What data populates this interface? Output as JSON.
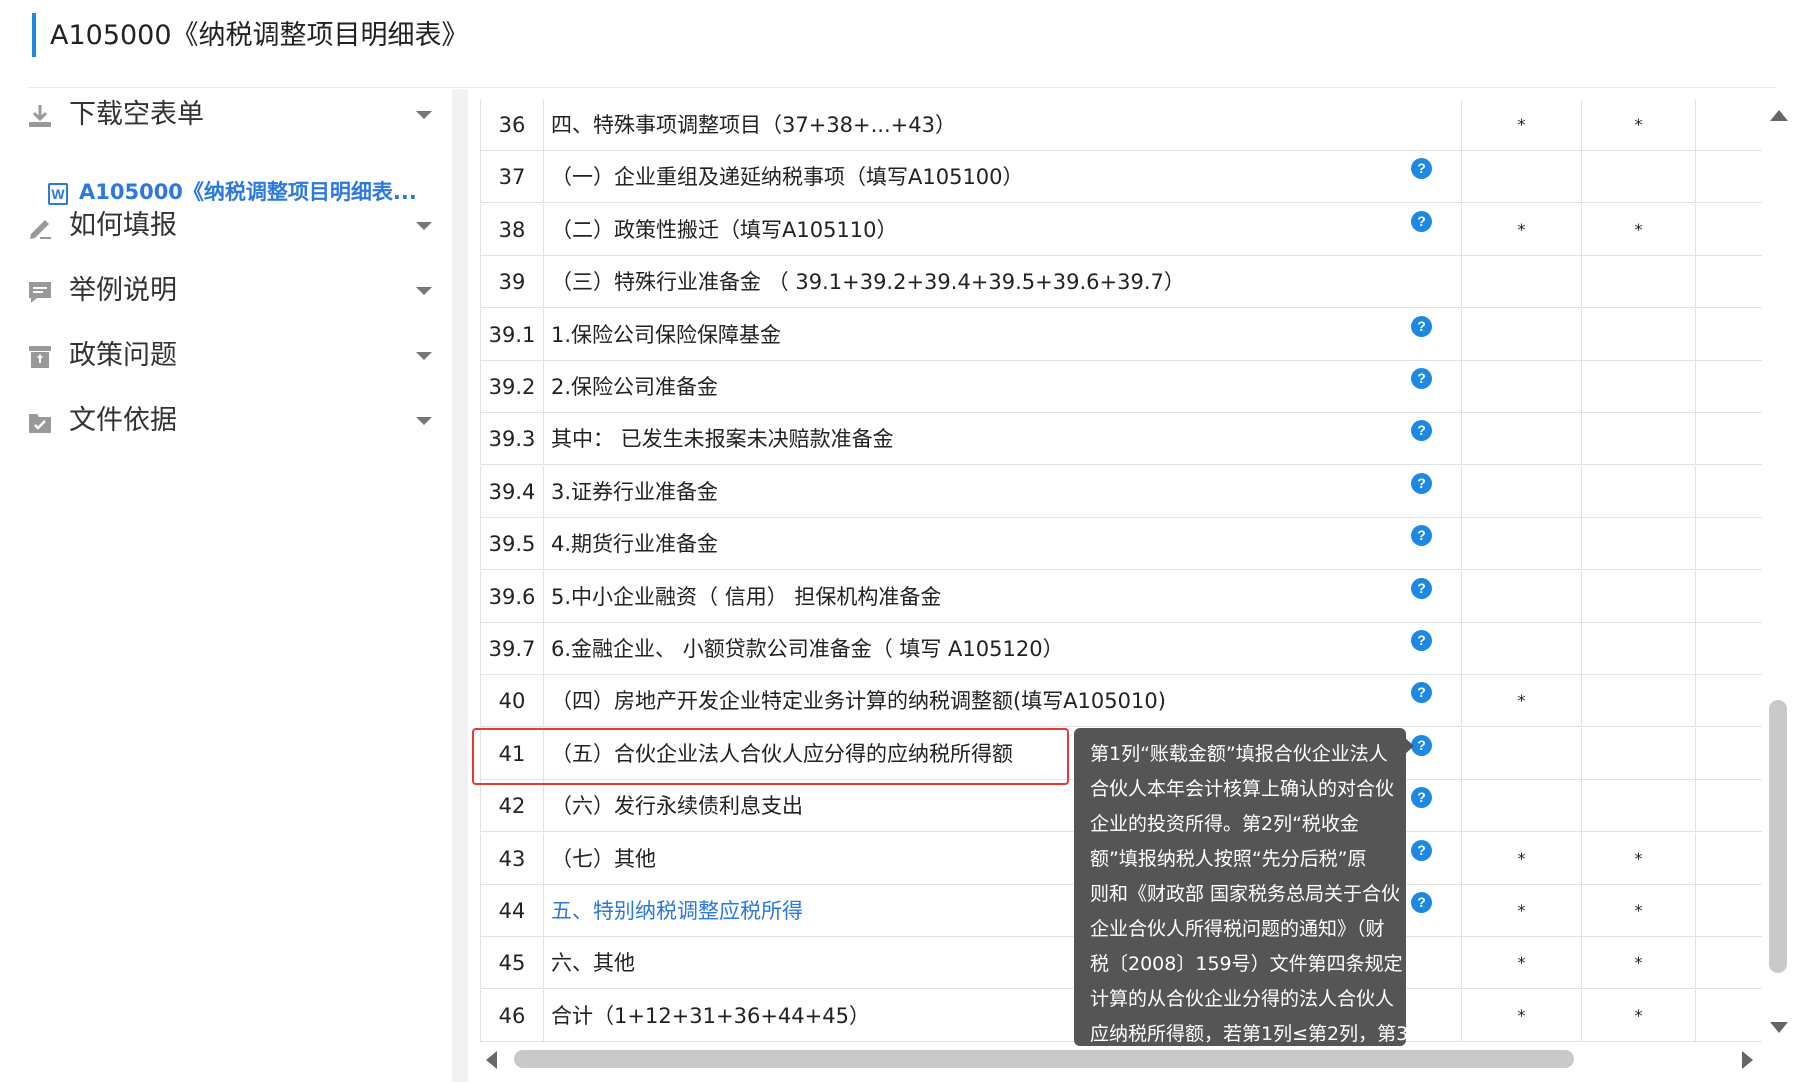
{
  "header": {
    "title": "A105000《纳税调整项目明细表》"
  },
  "sidebar": {
    "items": [
      {
        "label": "下载空表单",
        "icon": "download-icon"
      },
      {
        "label": "如何填报",
        "icon": "pencil-icon"
      },
      {
        "label": "举例说明",
        "icon": "message-icon"
      },
      {
        "label": "政策问题",
        "icon": "archive-icon"
      },
      {
        "label": "文件依据",
        "icon": "folder-check-icon"
      }
    ],
    "sub_item": {
      "label": "A105000《纳税调整项目明细表...",
      "icon": "word-doc-icon"
    }
  },
  "table": {
    "rows": [
      {
        "num": "36",
        "name": "四、特殊事项调整项目（37+38+...+43）",
        "a": "*",
        "b": "*"
      },
      {
        "num": "37",
        "name": "（一）企业重组及递延纳税事项（填写A105100）",
        "a": "",
        "b": ""
      },
      {
        "num": "38",
        "name": "（二）政策性搬迁（填写A105110）",
        "a": "*",
        "b": "*"
      },
      {
        "num": "39",
        "name": "（三）特殊行业准备金 （ 39.1+39.2+39.4+39.5+39.6+39.7）",
        "a": "",
        "b": ""
      },
      {
        "num": "39.1",
        "name": "1.保险公司保险保障基金",
        "a": "",
        "b": ""
      },
      {
        "num": "39.2",
        "name": "2.保险公司准备金",
        "a": "",
        "b": ""
      },
      {
        "num": "39.3",
        "name": "其中： 已发生未报案未决赔款准备金",
        "a": "",
        "b": ""
      },
      {
        "num": "39.4",
        "name": "3.证券行业准备金",
        "a": "",
        "b": ""
      },
      {
        "num": "39.5",
        "name": "4.期货行业准备金",
        "a": "",
        "b": ""
      },
      {
        "num": "39.6",
        "name": "5.中小企业融资（ 信用） 担保机构准备金",
        "a": "",
        "b": ""
      },
      {
        "num": "39.7",
        "name": "6.金融企业、 小额贷款公司准备金（ 填写 A105120）",
        "a": "",
        "b": ""
      },
      {
        "num": "40",
        "name": "（四）房地产开发企业特定业务计算的纳税调整额(填写A105010)",
        "a": "*",
        "b": ""
      },
      {
        "num": "41",
        "name": "（五）合伙企业法人合伙人应分得的应纳税所得额",
        "a": "",
        "b": ""
      },
      {
        "num": "42",
        "name": "（六）发行永续债利息支出",
        "a": "",
        "b": ""
      },
      {
        "num": "43",
        "name": "（七）其他",
        "a": "*",
        "b": "*"
      },
      {
        "num": "44",
        "name": "五、特别纳税调整应税所得",
        "a": "*",
        "b": "*"
      },
      {
        "num": "45",
        "name": "六、其他",
        "a": "*",
        "b": "*"
      },
      {
        "num": "46",
        "name": "合计（1+12+31+36+44+45）",
        "a": "*",
        "b": "*"
      }
    ],
    "help_icon": "?"
  },
  "tooltip": {
    "lines": [
      "第1列“账载金额”填报合伙企业法人",
      "合伙人本年会计核算上确认的对合伙",
      "企业的投资所得。第2列“税收金",
      "额”填报纳税人按照“先分后税”原",
      "则和《财政部 国家税务总局关于合伙",
      "企业合伙人所得税问题的通知》（财",
      "税〔2008〕159号）文件第四条规定",
      "计算的从合伙企业分得的法人合伙人",
      "应纳税所得额，若第1列≤第2列，第3"
    ]
  },
  "colors": {
    "accent": "#1e88e5",
    "link": "#2b79e0",
    "highlight": "#e53935",
    "tooltip_bg": "#555555"
  }
}
